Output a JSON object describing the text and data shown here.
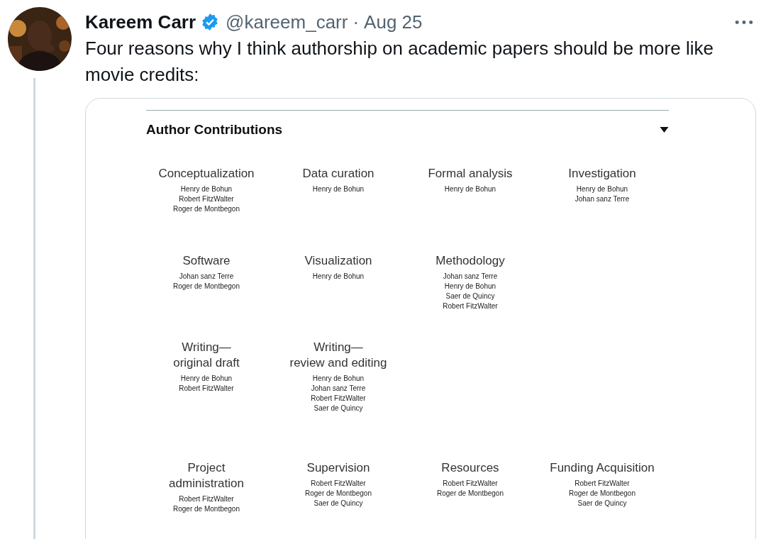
{
  "tweet": {
    "author": {
      "name": "Kareem Carr",
      "verified": true,
      "handle": "@kareem_carr",
      "separator": "·",
      "date": "Aug 25"
    },
    "text": "Four reasons why I think authorship on academic papers should be more like movie credits:",
    "media": {
      "heading": "Author Contributions",
      "expanded": true,
      "rows": [
        [
          {
            "title": "Conceptualization",
            "names": [
              "Henry de Bohun",
              "Robert FitzWalter",
              "Roger de Montbegon"
            ]
          },
          {
            "title": "Data curation",
            "names": [
              "Henry de Bohun"
            ]
          },
          {
            "title": "Formal analysis",
            "names": [
              "Henry de Bohun"
            ]
          },
          {
            "title": "Investigation",
            "names": [
              "Henry de Bohun",
              "Johan sanz Terre"
            ]
          }
        ],
        [
          {
            "title": "Software",
            "names": [
              "Johan sanz Terre",
              "Roger de Montbegon"
            ]
          },
          {
            "title": "Visualization",
            "names": [
              "Henry de Bohun"
            ]
          },
          {
            "title": "Methodology",
            "names": [
              "Johan sanz Terre",
              "Henry de Bohun",
              "Saer de Quincy",
              "Robert FitzWalter"
            ]
          }
        ],
        [
          {
            "title": "Writing—\noriginal draft",
            "names": [
              "Henry de Bohun",
              "Robert FitzWalter"
            ]
          },
          {
            "title": "Writing—\nreview and editing",
            "names": [
              "Henry de Bohun",
              "Johan sanz Terre",
              "Robert FitzWalter",
              "Saer de Quincy"
            ]
          }
        ],
        [
          {
            "title": "Project\nadministration",
            "names": [
              "Robert FitzWalter",
              "Roger de Montbegon"
            ]
          },
          {
            "title": "Supervision",
            "names": [
              "Robert FitzWalter",
              "Roger de Montbegon",
              "Saer de Quincy"
            ]
          },
          {
            "title": "Resources",
            "names": [
              "Robert FitzWalter",
              "Roger de Montbegon"
            ]
          },
          {
            "title": "Funding Acquisition",
            "names": [
              "Robert FitzWalter",
              "Roger de Montbegon",
              "Saer de Quincy"
            ]
          }
        ]
      ]
    }
  }
}
